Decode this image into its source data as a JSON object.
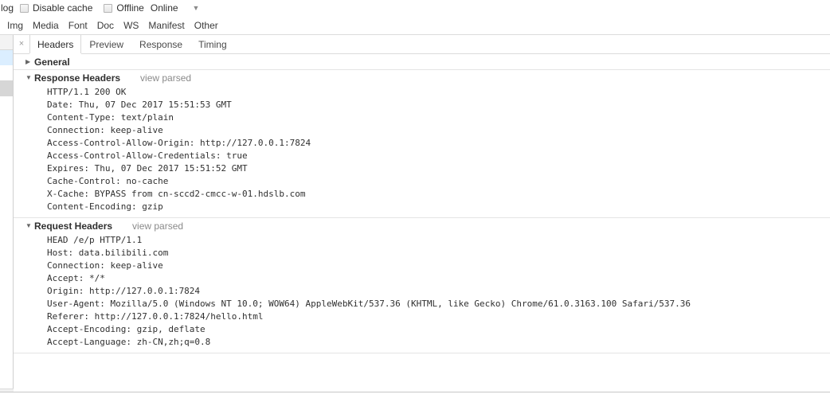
{
  "toolbar": {
    "preserve_log_label": "log",
    "disable_cache_label": "Disable cache",
    "offline_label": "Offline",
    "throttle_label": "Online",
    "throttle_caret": "▼"
  },
  "filters": {
    "items": [
      {
        "label": "Img"
      },
      {
        "label": "Media"
      },
      {
        "label": "Font"
      },
      {
        "label": "Doc"
      },
      {
        "label": "WS"
      },
      {
        "label": "Manifest"
      },
      {
        "label": "Other"
      }
    ]
  },
  "detail": {
    "close_glyph": "×",
    "tabs": [
      {
        "label": "Headers",
        "active": true
      },
      {
        "label": "Preview",
        "active": false
      },
      {
        "label": "Response",
        "active": false
      },
      {
        "label": "Timing",
        "active": false
      }
    ],
    "sections": [
      {
        "id": "general",
        "title": "General",
        "twisty": "▶",
        "expanded": false,
        "view_parsed": "",
        "lines": []
      },
      {
        "id": "response-headers",
        "title": "Response Headers",
        "twisty": "▼",
        "expanded": true,
        "view_parsed": "view parsed",
        "lines": [
          "HTTP/1.1 200 OK",
          "Date: Thu, 07 Dec 2017 15:51:53 GMT",
          "Content-Type: text/plain",
          "Connection: keep-alive",
          "Access-Control-Allow-Origin: http://127.0.0.1:7824",
          "Access-Control-Allow-Credentials: true",
          "Expires: Thu, 07 Dec 2017 15:51:52 GMT",
          "Cache-Control: no-cache",
          "X-Cache: BYPASS from cn-sccd2-cmcc-w-01.hdslb.com",
          "Content-Encoding: gzip"
        ]
      },
      {
        "id": "request-headers",
        "title": "Request Headers",
        "twisty": "▼",
        "expanded": true,
        "view_parsed": "view parsed",
        "lines": [
          "HEAD /e/p HTTP/1.1",
          "Host: data.bilibili.com",
          "Connection: keep-alive",
          "Accept: */*",
          "Origin: http://127.0.0.1:7824",
          "User-Agent: Mozilla/5.0 (Windows NT 10.0; WOW64) AppleWebKit/537.36 (KHTML, like Gecko) Chrome/61.0.3163.100 Safari/537.36",
          "Referer: http://127.0.0.1:7824/hello.html",
          "Accept-Encoding: gzip, deflate",
          "Accept-Language: zh-CN,zh;q=0.8"
        ]
      }
    ]
  },
  "colors": {
    "selection": "#dbeeff",
    "panel_border": "#dcdcdc",
    "text": "#303030",
    "muted": "#8a8a8a"
  }
}
